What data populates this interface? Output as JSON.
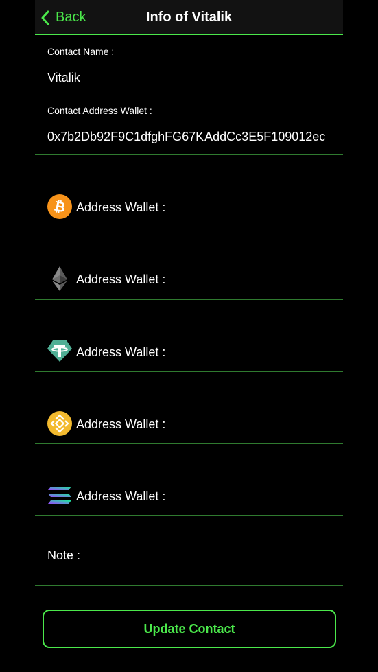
{
  "nav": {
    "back_label": "Back",
    "title": "Info of Vitalik"
  },
  "contact": {
    "name_label": "Contact Name :",
    "name_value": "Vitalik",
    "address_label": "Contact Address Wallet :",
    "address_value_before_cursor": "0x7b2Db92F9C1dfghFG67K",
    "address_value_after_cursor": "AddCc3E5F109012ec"
  },
  "wallets": [
    {
      "icon": "bitcoin-icon",
      "label": "Address Wallet :"
    },
    {
      "icon": "ethereum-icon",
      "label": "Address Wallet :"
    },
    {
      "icon": "tether-icon",
      "label": "Address Wallet :"
    },
    {
      "icon": "bnb-icon",
      "label": "Address Wallet :"
    },
    {
      "icon": "solana-icon",
      "label": "Address Wallet :"
    }
  ],
  "note": {
    "label": "Note :"
  },
  "actions": {
    "update_label": "Update Contact"
  },
  "colors": {
    "accent": "#4be84b",
    "divider": "#2f7a2f",
    "background": "#000000",
    "nav_background": "#121212"
  }
}
